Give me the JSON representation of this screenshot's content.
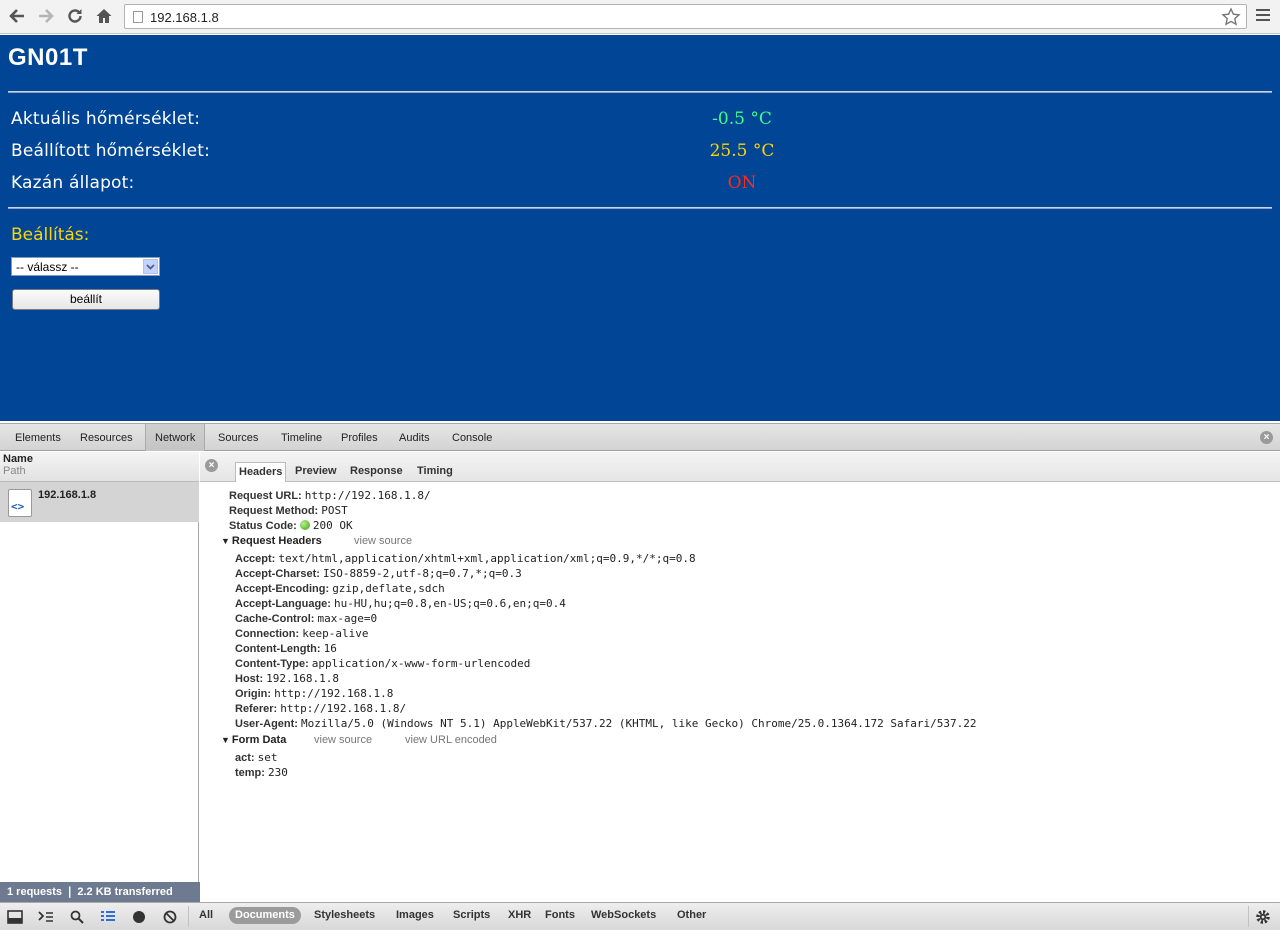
{
  "browser": {
    "url": "192.168.1.8"
  },
  "page": {
    "title": "GN01T",
    "rows": [
      {
        "label": "Aktuális hőmérséklet:",
        "value": "-0.5 °C",
        "color": "#3cff8a"
      },
      {
        "label": "Beállított hőmérséklet:",
        "value": "25.5 °C",
        "color": "#ffd400"
      },
      {
        "label": "Kazán állapot:",
        "value": "ON",
        "color": "#ff2a1a"
      }
    ],
    "setting_title": "Beállítás:",
    "select_value": "-- válassz --",
    "button_label": "beállít"
  },
  "devtools": {
    "tabs": [
      "Elements",
      "Resources",
      "Network",
      "Sources",
      "Timeline",
      "Profiles",
      "Audits",
      "Console"
    ],
    "active_tab": "Network",
    "left": {
      "col_name": "Name",
      "col_path": "Path",
      "request_name": "192.168.1.8",
      "status": "1 requests   ❘   2.2 KB transferred"
    },
    "detail_tabs": [
      "Headers",
      "Preview",
      "Response",
      "Timing"
    ],
    "general": [
      {
        "k": "Request URL:",
        "v": "http://192.168.1.8/"
      },
      {
        "k": "Request Method:",
        "v": "POST"
      },
      {
        "k": "Status Code:",
        "v": "200 OK"
      }
    ],
    "request_headers_title": "Request Headers",
    "view_source": "view source",
    "request_headers": [
      {
        "k": "Accept:",
        "v": "text/html,application/xhtml+xml,application/xml;q=0.9,*/*;q=0.8"
      },
      {
        "k": "Accept-Charset:",
        "v": "ISO-8859-2,utf-8;q=0.7,*;q=0.3"
      },
      {
        "k": "Accept-Encoding:",
        "v": "gzip,deflate,sdch"
      },
      {
        "k": "Accept-Language:",
        "v": "hu-HU,hu;q=0.8,en-US;q=0.6,en;q=0.4"
      },
      {
        "k": "Cache-Control:",
        "v": "max-age=0"
      },
      {
        "k": "Connection:",
        "v": "keep-alive"
      },
      {
        "k": "Content-Length:",
        "v": "16"
      },
      {
        "k": "Content-Type:",
        "v": "application/x-www-form-urlencoded"
      },
      {
        "k": "Host:",
        "v": "192.168.1.8"
      },
      {
        "k": "Origin:",
        "v": "http://192.168.1.8"
      },
      {
        "k": "Referer:",
        "v": "http://192.168.1.8/"
      },
      {
        "k": "User-Agent:",
        "v": "Mozilla/5.0 (Windows NT 5.1) AppleWebKit/537.22 (KHTML, like Gecko) Chrome/25.0.1364.172 Safari/537.22"
      }
    ],
    "form_data_title": "Form Data",
    "view_url_encoded": "view URL encoded",
    "form_data": [
      {
        "k": "act:",
        "v": "set"
      },
      {
        "k": "temp:",
        "v": "230"
      }
    ],
    "filters": [
      "All",
      "Documents",
      "Stylesheets",
      "Images",
      "Scripts",
      "XHR",
      "Fonts",
      "WebSockets",
      "Other"
    ],
    "active_filter": "Documents"
  }
}
